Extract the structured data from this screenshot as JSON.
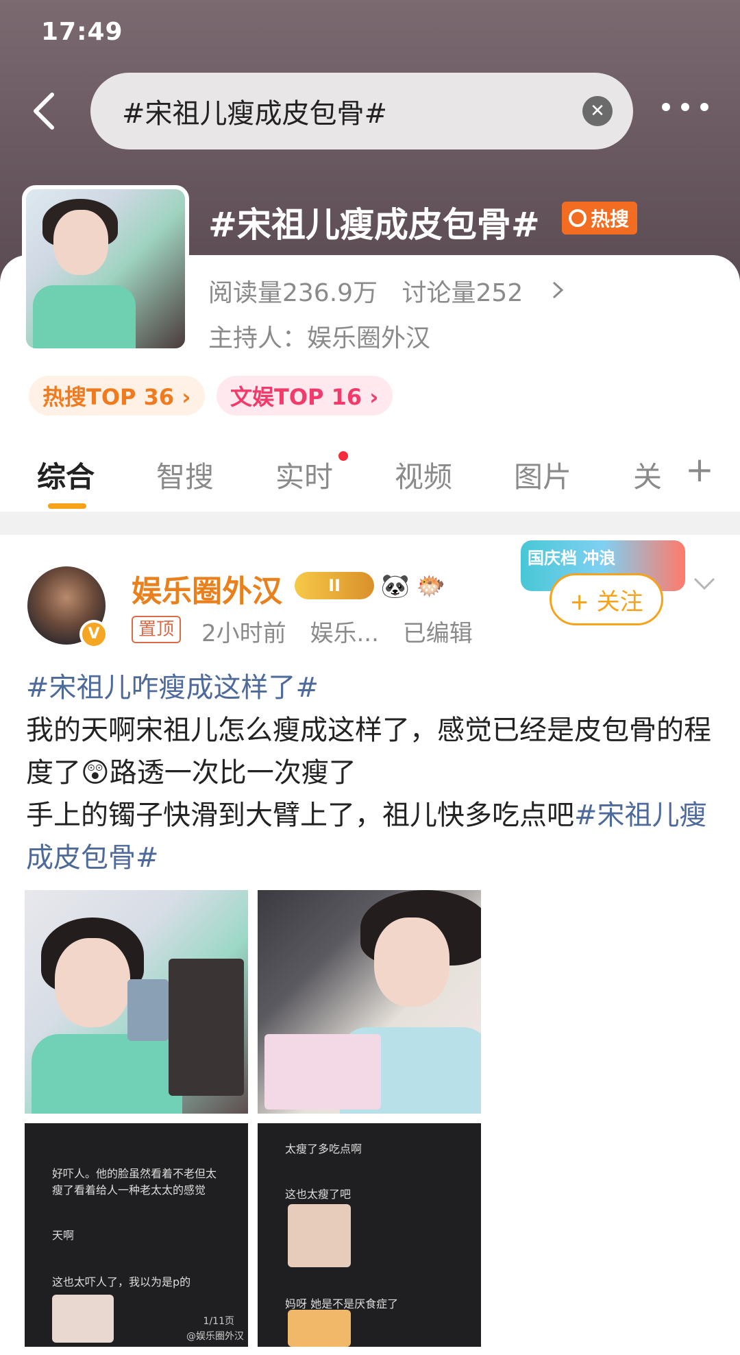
{
  "status_bar": {
    "time": "17:49"
  },
  "search": {
    "query": "#宋祖儿瘦成皮包骨#"
  },
  "topic": {
    "title": "#宋祖儿瘦成皮包骨#",
    "hot_label": "热搜",
    "reads": "阅读量236.9万",
    "discussions": "讨论量252",
    "host": "主持人：娱乐圈外汉",
    "rank_pills": [
      "热搜TOP 36 ›",
      "文娱TOP 16 ›"
    ]
  },
  "tabs": [
    {
      "label": "综合",
      "active": true
    },
    {
      "label": "智搜",
      "active": false
    },
    {
      "label": "实时",
      "active": false,
      "dot": true
    },
    {
      "label": "视频",
      "active": false
    },
    {
      "label": "图片",
      "active": false
    },
    {
      "label": "关",
      "active": false
    }
  ],
  "tab_add": "+",
  "post": {
    "username": "娱乐圈外汉",
    "rank": "II",
    "pinned": "置顶",
    "time": "2小时前",
    "source": "娱乐...",
    "edited": "已编辑",
    "follow_label": "+ 关注",
    "festival_badge": "国庆档 冲浪",
    "text": {
      "tag1": "#宋祖儿咋瘦成这样了#",
      "line1": "我的天啊宋祖儿怎么瘦成这样了，感觉已经是皮包骨的程度了😲路透一次比一次瘦了",
      "line2": "手上的镯子快滑到大臂上了，祖儿快多吃点吧",
      "tag2": "#宋祖儿瘦成皮包骨#"
    },
    "images": {
      "img3_chat": [
        "好吓人。他的脸虽然看着不老但太瘦了看着给人一种老太太的感觉",
        "天啊",
        "这也太吓人了，我以为是p的"
      ],
      "img3_page": "1/11页",
      "img3_watermark": "@娱乐圈外汉",
      "img4_chat": [
        "太瘦了多吃点啊",
        "这也太瘦了吧",
        "妈呀 她是不是厌食症了"
      ]
    }
  }
}
